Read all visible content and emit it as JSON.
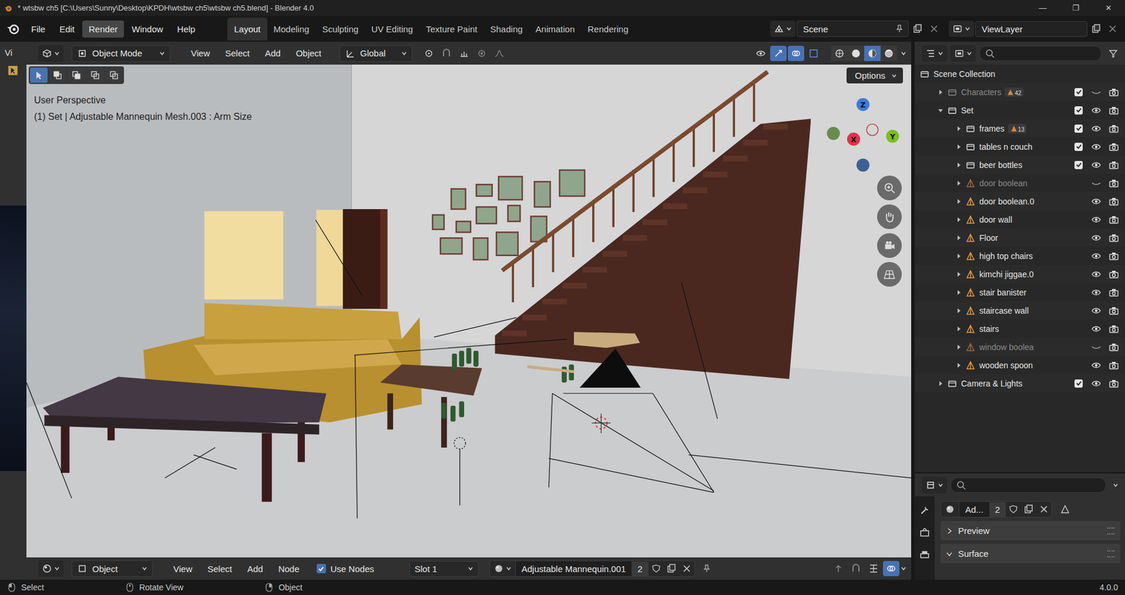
{
  "window": {
    "title": "* wtsbw ch5 [C:\\Users\\Sunny\\Desktop\\KPDH\\wtsbw ch5\\wtsbw ch5.blend] - Blender 4.0",
    "controls": [
      "—",
      "❐",
      "✕"
    ]
  },
  "menu": [
    {
      "label": "File",
      "highlighted": false
    },
    {
      "label": "Edit",
      "highlighted": false
    },
    {
      "label": "Render",
      "highlighted": true
    },
    {
      "label": "Window",
      "highlighted": false
    },
    {
      "label": "Help",
      "highlighted": false
    }
  ],
  "workspaces": [
    {
      "label": "Layout",
      "selected": true
    },
    {
      "label": "Modeling",
      "selected": false
    },
    {
      "label": "Sculpting",
      "selected": false
    },
    {
      "label": "UV Editing",
      "selected": false
    },
    {
      "label": "Texture Paint",
      "selected": false
    },
    {
      "label": "Shading",
      "selected": false
    },
    {
      "label": "Animation",
      "selected": false
    },
    {
      "label": "Rendering",
      "selected": false
    }
  ],
  "scene": {
    "name": "Scene"
  },
  "view_layer": {
    "name": "ViewLayer"
  },
  "left_editor": {
    "label": "Vi"
  },
  "viewport": {
    "mode": "Object Mode",
    "menus": [
      "View",
      "Select",
      "Add",
      "Object"
    ],
    "orientation": "Global",
    "options": "Options",
    "perspective": "User Perspective",
    "info": "(1) Set | Adjustable Mannequin Mesh.003 : Arm Size",
    "select_modes": [
      {
        "selected": true
      },
      {
        "selected": false
      },
      {
        "selected": false
      },
      {
        "selected": false
      },
      {
        "selected": false
      }
    ],
    "toggles": [
      {
        "selected": false
      },
      {
        "selected": true
      },
      {
        "selected": true
      },
      {
        "selected": false
      }
    ],
    "shading": [
      {
        "selected": false
      },
      {
        "selected": false
      },
      {
        "selected": true
      },
      {
        "selected": false
      }
    ],
    "gizmo": [
      {
        "label": "Z",
        "color": "#3d7bd9"
      },
      {
        "label": "X",
        "color": "#e0324a"
      },
      {
        "label": "Y",
        "color": "#7fbd1f"
      }
    ]
  },
  "shader_header": {
    "editor": "Object",
    "menus": [
      "View",
      "Select",
      "Add",
      "Node"
    ],
    "use_nodes": {
      "label": "Use Nodes",
      "checked": true
    },
    "slot": "Slot 1",
    "material": "Adjustable Mannequin.001",
    "users": "2"
  },
  "outliner": {
    "rows": [
      {
        "name": "Scene Collection",
        "depth": 0,
        "kind": "scene",
        "expanded": true,
        "dimmed": false,
        "badge": "",
        "checked": false,
        "visible": true
      },
      {
        "name": "Characters",
        "depth": 1,
        "kind": "collection",
        "expanded": false,
        "dimmed": true,
        "badge": "42",
        "checked": true,
        "visible": false
      },
      {
        "name": "Set",
        "depth": 1,
        "kind": "collection",
        "expanded": true,
        "dimmed": false,
        "badge": "",
        "checked": true,
        "visible": true
      },
      {
        "name": "frames",
        "depth": 2,
        "kind": "collection",
        "expanded": false,
        "dimmed": false,
        "badge": "13",
        "checked": true,
        "visible": true
      },
      {
        "name": "tables n couch",
        "depth": 2,
        "kind": "collection",
        "expanded": false,
        "dimmed": false,
        "badge": "",
        "checked": true,
        "visible": true
      },
      {
        "name": "beer bottles",
        "depth": 2,
        "kind": "collection",
        "expanded": false,
        "dimmed": false,
        "badge": "",
        "checked": true,
        "visible": true
      },
      {
        "name": "door boolean",
        "depth": 2,
        "kind": "object",
        "expanded": false,
        "dimmed": true,
        "badge": "",
        "checked": false,
        "visible": false
      },
      {
        "name": "door boolean.0",
        "depth": 2,
        "kind": "object",
        "expanded": false,
        "dimmed": false,
        "badge": "",
        "checked": false,
        "visible": true
      },
      {
        "name": "door wall",
        "depth": 2,
        "kind": "object",
        "expanded": false,
        "dimmed": false,
        "badge": "",
        "checked": false,
        "visible": true
      },
      {
        "name": "Floor",
        "depth": 2,
        "kind": "object",
        "expanded": false,
        "dimmed": false,
        "badge": "",
        "checked": false,
        "visible": true
      },
      {
        "name": "high top chairs",
        "depth": 2,
        "kind": "object",
        "expanded": false,
        "dimmed": false,
        "badge": "",
        "checked": false,
        "visible": true
      },
      {
        "name": "kimchi jiggae.0",
        "depth": 2,
        "kind": "object",
        "expanded": false,
        "dimmed": false,
        "badge": "",
        "checked": false,
        "visible": true
      },
      {
        "name": "stair banister",
        "depth": 2,
        "kind": "object",
        "expanded": false,
        "dimmed": false,
        "badge": "",
        "checked": false,
        "visible": true
      },
      {
        "name": "staircase wall",
        "depth": 2,
        "kind": "object",
        "expanded": false,
        "dimmed": false,
        "badge": "",
        "checked": false,
        "visible": true
      },
      {
        "name": "stairs",
        "depth": 2,
        "kind": "object",
        "expanded": false,
        "dimmed": false,
        "badge": "",
        "checked": false,
        "visible": true
      },
      {
        "name": "window boolea",
        "depth": 2,
        "kind": "object",
        "expanded": false,
        "dimmed": true,
        "badge": "",
        "checked": false,
        "visible": false
      },
      {
        "name": "wooden spoon",
        "depth": 2,
        "kind": "object",
        "expanded": false,
        "dimmed": false,
        "badge": "",
        "checked": false,
        "visible": true
      },
      {
        "name": "Camera & Lights",
        "depth": 1,
        "kind": "collection",
        "expanded": false,
        "dimmed": false,
        "badge": "",
        "checked": true,
        "visible": true
      }
    ]
  },
  "properties": {
    "material": "Ad...",
    "users": "2",
    "panels": [
      {
        "label": "Preview",
        "expanded": false
      },
      {
        "label": "Surface",
        "expanded": true
      }
    ]
  },
  "status_bar": {
    "items": [
      "Select",
      "Rotate View",
      "Object"
    ],
    "version": "4.0.0"
  }
}
